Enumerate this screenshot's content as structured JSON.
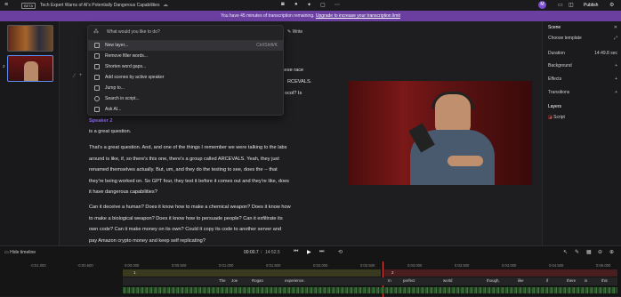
{
  "topbar": {
    "app_badge": "BETA",
    "title": "Tech Expert Warns of AI's Potentially Dangerous Capabilities",
    "avatar": "M",
    "publish": "Publish"
  },
  "banner": {
    "text": "You have 45 minutes of transcription remaining.",
    "link": "Upgrade to increase your transcription limit"
  },
  "thumbs": {
    "second_number": "2"
  },
  "menu": {
    "placeholder": "What would you like to do?",
    "write": "Write",
    "items": [
      {
        "label": "New layer...",
        "shortcut": "Ctrl/Shift/K",
        "icon": "layer-icon"
      },
      {
        "label": "Remove filler words...",
        "icon": "filter-icon"
      },
      {
        "label": "Shorten word gaps...",
        "icon": "gap-icon"
      },
      {
        "label": "Add scenes by active speaker",
        "icon": "scene-icon"
      },
      {
        "label": "Jump to...",
        "icon": "bookmark-icon"
      },
      {
        "label": "Search in script...",
        "icon": "search-icon"
      },
      {
        "label": "Ask AI...",
        "icon": "sparkle-icon"
      }
    ]
  },
  "editor": {
    "frag1": "these race",
    "frag2": "RCEVALS.",
    "frag3": "ocol? Is",
    "speaker": "Speaker 2",
    "line_intro": "is a great question.",
    "p1": [
      "That's a great question. And, and one of the things I remember we were talking to the labs",
      "around is like, if, so there's this one, there's a group called ARCEVALS. Yeah, they just",
      "renamed themselves actually. But, um, and they do the testing to see, does the -- that",
      "they're being worked on. So GPT four, they test it before it comes out and they're like, does",
      "it have dangerous capabilities?"
    ],
    "p2": [
      "Can it deceive a human? Does it know how to make a chemical weapon? Does it know how",
      "to make a biological weapon? Does it know how to persuade people? Can it exfiltrate its",
      "own code? Can it make money on its own? Could it copy its code to another server and",
      "pay Amazon crypto money and keep self replicating?"
    ]
  },
  "right": {
    "scene": "Scene",
    "template": "Choose template",
    "duration_label": "Duration",
    "duration_value": "14:49.8 sec",
    "background": "Background",
    "effects": "Effects",
    "transitions": "Transitions",
    "layers": "Layers",
    "script": "Script"
  },
  "timeline": {
    "hide": "Hide timeline",
    "time": "00:00.7",
    "total": "14:52.5",
    "ticks": [
      "-0:01.000",
      "-0:00.500",
      "0:00.000",
      "0:00.500",
      "0:01.000",
      "0:01.500",
      "0:02.000",
      "0:02.500",
      "0:03.000",
      "0:03.500",
      "0:04.000",
      "0:04.500",
      "0:05.000"
    ],
    "track1": "1",
    "track2": "2",
    "words": [
      "The",
      "Joe",
      "Rogan",
      "experience.",
      "In",
      "perfect",
      "world",
      "though,",
      "like",
      "if",
      "there",
      "is",
      "this"
    ]
  }
}
